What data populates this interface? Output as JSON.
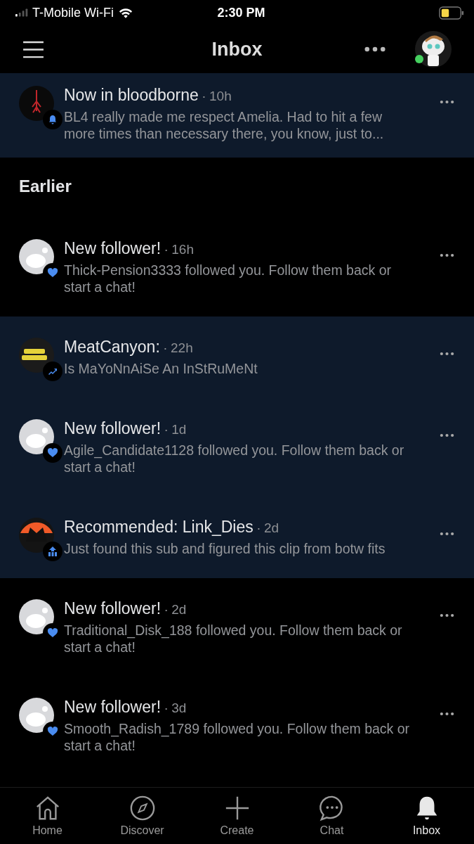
{
  "status_bar": {
    "carrier": "T-Mobile Wi-Fi",
    "time": "2:30 PM"
  },
  "header": {
    "title": "Inbox",
    "online": true
  },
  "notifications": [
    {
      "kind": "subscription",
      "title": "Now in bloodborne",
      "separator": "·",
      "time": "10h",
      "body": "BL4 really made me respect Amelia. Had to hit a few more times than necessary there, you know, just to...",
      "unread": true
    }
  ],
  "section": {
    "title": "Earlier"
  },
  "earlier": [
    {
      "kind": "follower",
      "title": "New follower!",
      "separator": "·",
      "time": "16h",
      "body": "Thick-Pension3333 followed you. Follow them back or start a chat!",
      "unread": false
    },
    {
      "kind": "trending",
      "title": "MeatCanyon:",
      "separator": "·",
      "time": "22h",
      "body": "Is MaYoNnAiSe An InStRuMeNt",
      "unread": true
    },
    {
      "kind": "follower",
      "title": "New follower!",
      "separator": "·",
      "time": "1d",
      "body": "Agile_Candidate1128 followed you. Follow them back or start a chat!",
      "unread": true
    },
    {
      "kind": "recommendation",
      "title": "Recommended: Link_Dies",
      "separator": "·",
      "time": "2d",
      "body": "Just found this sub and figured this clip from botw fits",
      "unread": true
    },
    {
      "kind": "follower",
      "title": "New follower!",
      "separator": "·",
      "time": "2d",
      "body": "Traditional_Disk_188 followed you. Follow them back or start a chat!",
      "unread": false
    },
    {
      "kind": "follower",
      "title": "New follower!",
      "separator": "·",
      "time": "3d",
      "body": "Smooth_Radish_1789 followed you. Follow them back or start a chat!",
      "unread": false
    }
  ],
  "tabs": [
    {
      "label": "Home",
      "selected": false
    },
    {
      "label": "Discover",
      "selected": false
    },
    {
      "label": "Create",
      "selected": false
    },
    {
      "label": "Chat",
      "selected": false
    },
    {
      "label": "Inbox",
      "selected": true
    }
  ]
}
